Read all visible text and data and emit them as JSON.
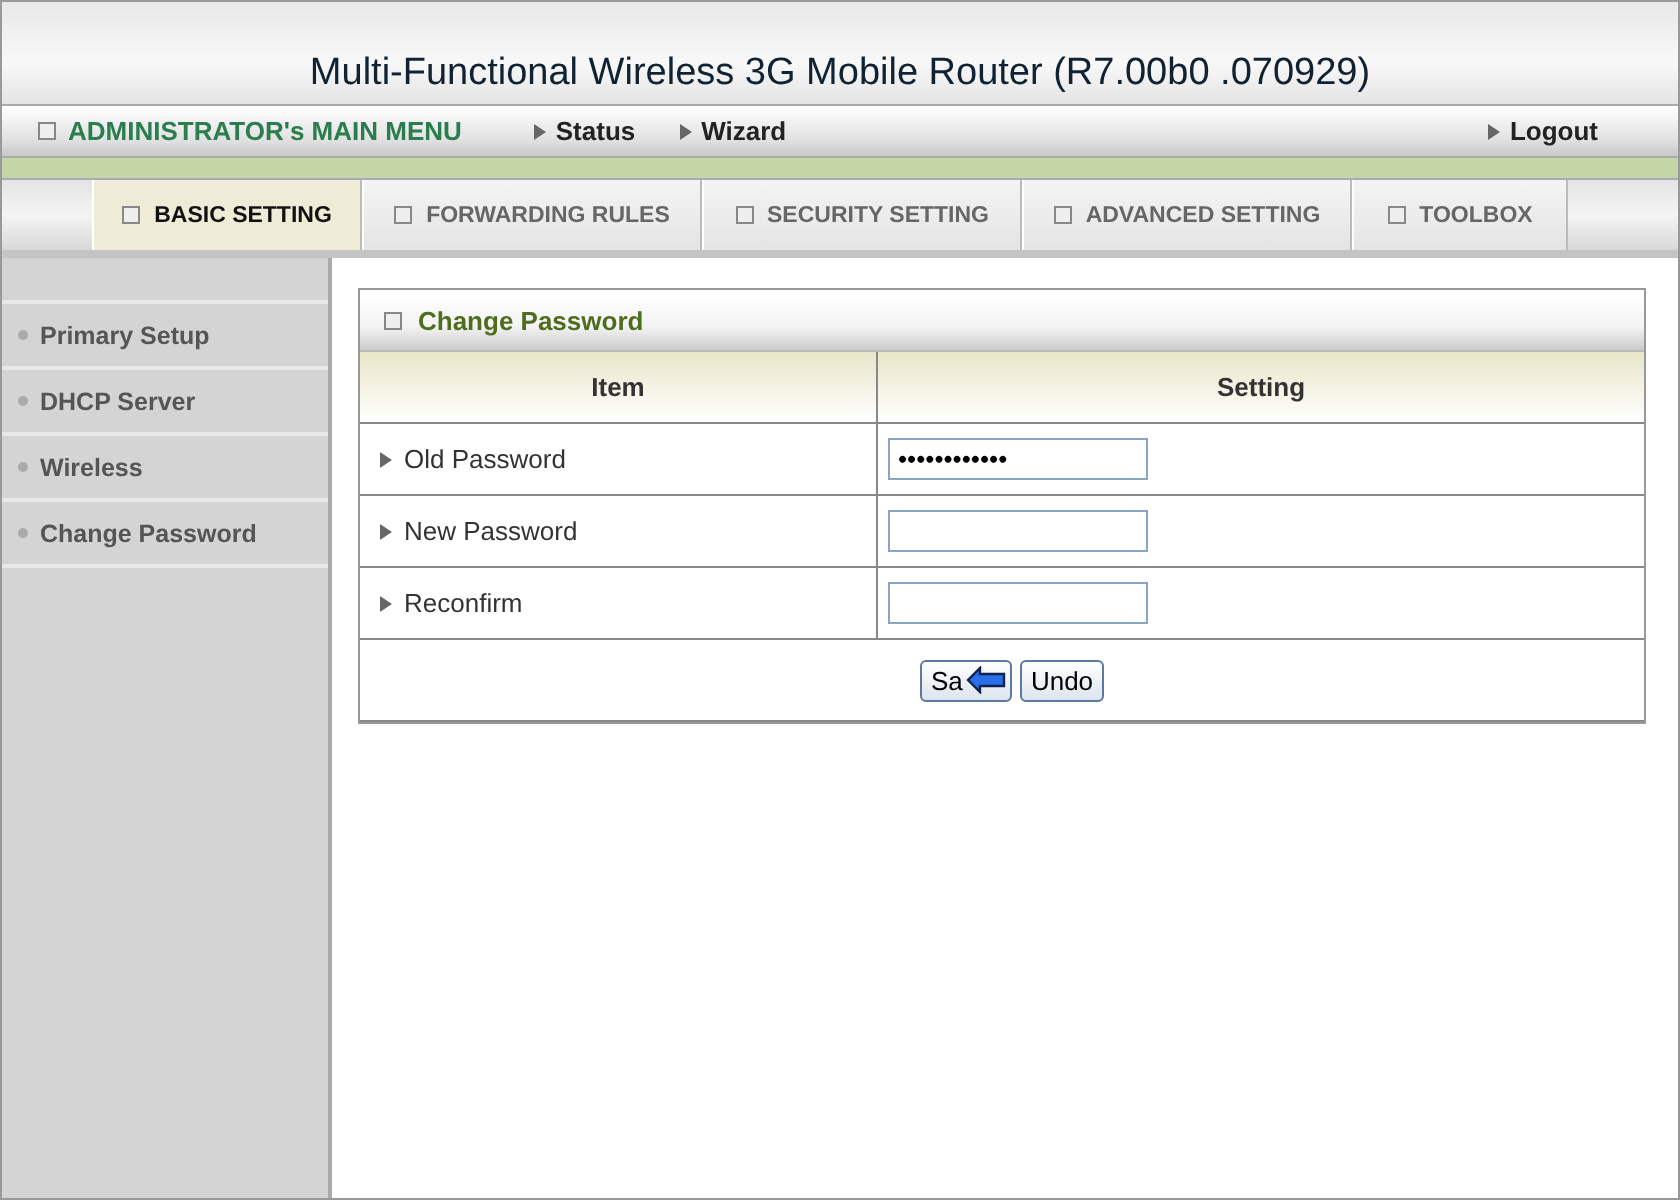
{
  "header": {
    "title": "Multi-Functional Wireless 3G Mobile Router (R7.00b0 .070929)"
  },
  "main_menu": {
    "title": "ADMINISTRATOR's MAIN MENU",
    "links": [
      "Status",
      "Wizard"
    ],
    "logout": "Logout"
  },
  "tabs": [
    {
      "label": "BASIC SETTING",
      "selected": true
    },
    {
      "label": "FORWARDING RULES",
      "selected": false
    },
    {
      "label": "SECURITY SETTING",
      "selected": false
    },
    {
      "label": "ADVANCED SETTING",
      "selected": false
    },
    {
      "label": "TOOLBOX",
      "selected": false
    }
  ],
  "sidebar": {
    "items": [
      "Primary Setup",
      "DHCP Server",
      "Wireless",
      "Change Password"
    ]
  },
  "panel": {
    "title": "Change Password",
    "columns": [
      "Item",
      "Setting"
    ],
    "rows": [
      {
        "label": "Old Password",
        "value": "••••••••••••"
      },
      {
        "label": "New Password"
      },
      {
        "label": "Reconfirm"
      }
    ],
    "buttons": [
      "Sa",
      "Undo"
    ]
  }
}
